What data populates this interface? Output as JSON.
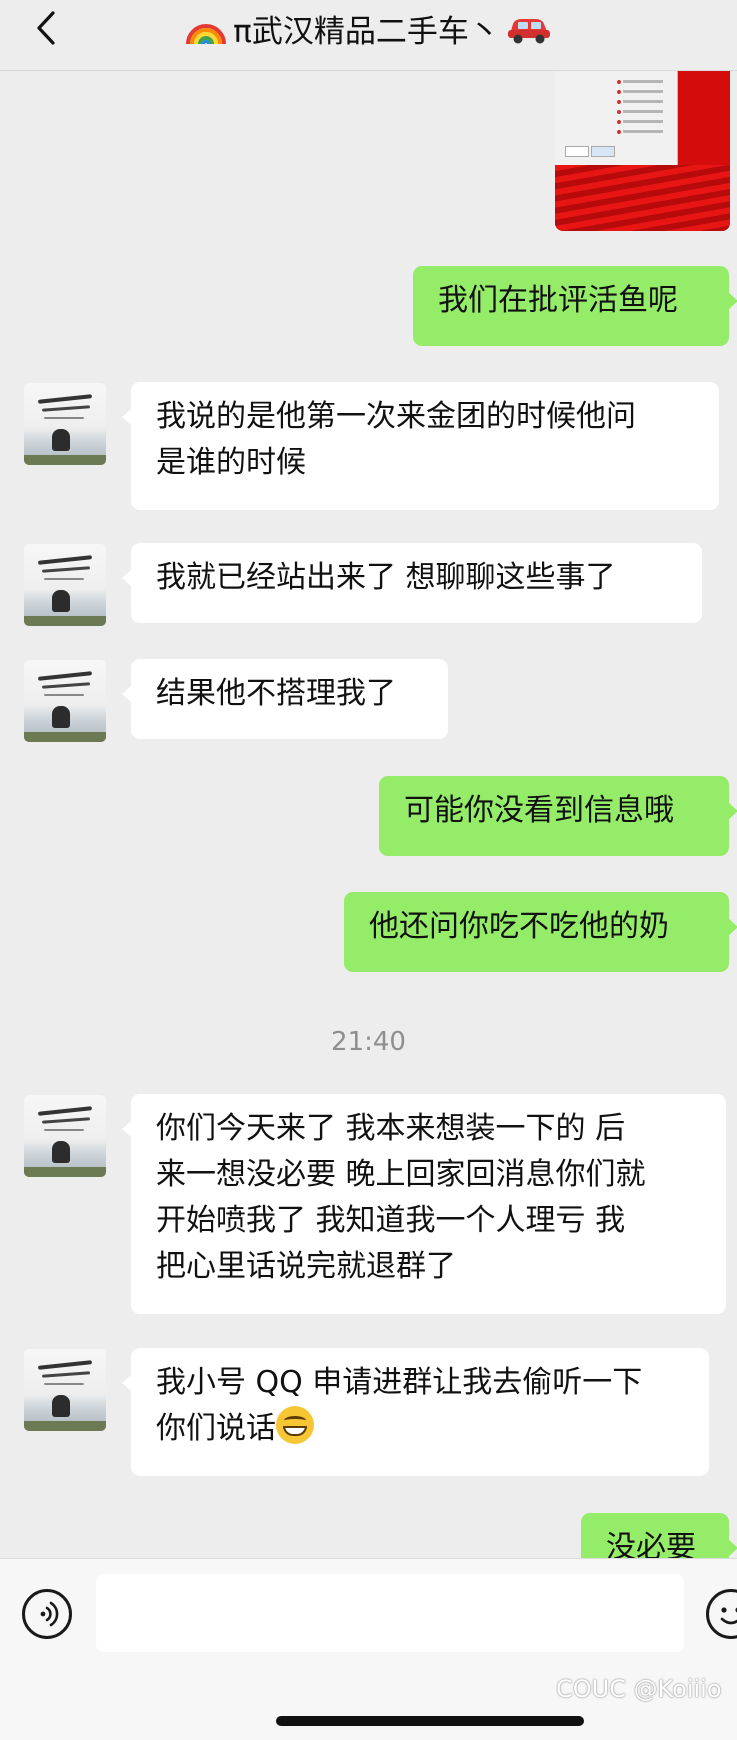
{
  "header": {
    "title_prefix_icon": "rainbow-emoji",
    "title": "π武汉精品二手车丶",
    "title_suffix_icon": "red-car-emoji",
    "back_icon": "chevron-left-icon"
  },
  "messages": [
    {
      "type": "image",
      "side": "right",
      "icon": "screenshot-thumbnail"
    },
    {
      "type": "text",
      "side": "right",
      "lines": [
        "我们在批评活鱼呢"
      ]
    },
    {
      "type": "text",
      "side": "left",
      "lines": [
        "我说的是他第一次来金团的时候他问",
        "是谁的时候"
      ]
    },
    {
      "type": "text",
      "side": "left",
      "lines": [
        "我就已经站出来了 想聊聊这些事了"
      ]
    },
    {
      "type": "text",
      "side": "left",
      "lines": [
        "结果他不搭理我了"
      ]
    },
    {
      "type": "text",
      "side": "right",
      "lines": [
        "可能你没看到信息哦"
      ]
    },
    {
      "type": "text",
      "side": "right",
      "lines": [
        "他还问你吃不吃他的奶"
      ]
    },
    {
      "type": "timestamp",
      "text": "21:40"
    },
    {
      "type": "text",
      "side": "left",
      "lines": [
        "你们今天来了 我本来想装一下的 后",
        "来一想没必要 晚上回家回消息你们就",
        "开始喷我了 我知道我一个人理亏 我",
        "把心里话说完就退群了"
      ]
    },
    {
      "type": "text",
      "side": "left",
      "lines": [
        "我小号 QQ 申请进群让我去偷听一下",
        "你们说话"
      ],
      "emoji": "grinning-face-emoji"
    },
    {
      "type": "text",
      "side": "right",
      "lines": [
        "没必要"
      ]
    }
  ],
  "input_bar": {
    "voice_icon": "voice-icon",
    "emoji_icon": "emoji-icon",
    "placeholder": ""
  },
  "watermark": "COUC @Koiiio",
  "colors": {
    "background": "#ededed",
    "sent_bubble": "#95ec69",
    "received_bubble": "#ffffff",
    "timestamp": "#8e8e8e"
  }
}
